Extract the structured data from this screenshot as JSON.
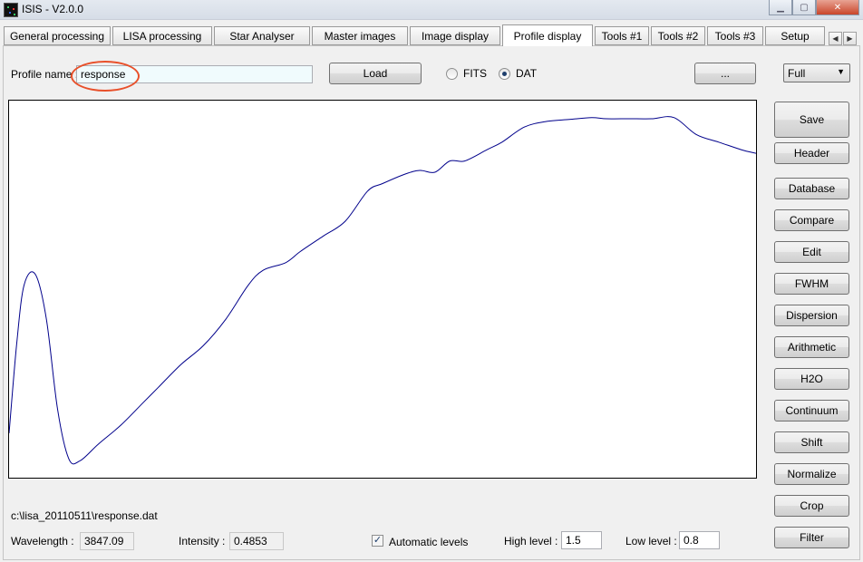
{
  "window": {
    "title": "ISIS - V2.0.0"
  },
  "tabs": [
    {
      "label": "General processing"
    },
    {
      "label": "LISA processing"
    },
    {
      "label": "Star Analyser"
    },
    {
      "label": "Master images"
    },
    {
      "label": "Image display"
    },
    {
      "label": "Profile display",
      "active": true
    },
    {
      "label": "Tools #1"
    },
    {
      "label": "Tools #2"
    },
    {
      "label": "Tools #3"
    },
    {
      "label": "Setup"
    }
  ],
  "profile": {
    "name_label": "Profile name :",
    "name_value": "response",
    "load_label": "Load",
    "format_fits": "FITS",
    "format_dat": "DAT",
    "selected_format": "DAT",
    "browse_label": "...",
    "zoom_value": "Full"
  },
  "side_buttons": {
    "save": "Save",
    "header": "Header",
    "database": "Database",
    "compare": "Compare",
    "edit": "Edit",
    "fwhm": "FWHM",
    "dispersion": "Dispersion",
    "arithmetic": "Arithmetic",
    "h2o": "H2O",
    "continuum": "Continuum",
    "shift": "Shift",
    "normalize": "Normalize",
    "crop": "Crop",
    "filter": "Filter"
  },
  "status": {
    "file_path": "c:\\lisa_20110511\\response.dat",
    "wavelength_label": "Wavelength :",
    "wavelength_value": "3847.09",
    "intensity_label": "Intensity :",
    "intensity_value": "0.4853",
    "auto_levels_label": "Automatic levels",
    "auto_levels_checked": true,
    "high_level_label": "High level :",
    "high_level_value": "1.5",
    "low_level_label": "Low level :",
    "low_level_value": "0.8"
  },
  "plot": {
    "line_color": "#00008b",
    "annotation_color": "#e8502a",
    "profile": [
      [
        0.0,
        0.882
      ],
      [
        0.01,
        0.65
      ],
      [
        0.02,
        0.49
      ],
      [
        0.035,
        0.46
      ],
      [
        0.05,
        0.58
      ],
      [
        0.065,
        0.82
      ],
      [
        0.08,
        0.95
      ],
      [
        0.095,
        0.955
      ],
      [
        0.12,
        0.91
      ],
      [
        0.15,
        0.86
      ],
      [
        0.18,
        0.8
      ],
      [
        0.2,
        0.76
      ],
      [
        0.23,
        0.7
      ],
      [
        0.26,
        0.65
      ],
      [
        0.29,
        0.58
      ],
      [
        0.32,
        0.49
      ],
      [
        0.34,
        0.45
      ],
      [
        0.37,
        0.43
      ],
      [
        0.39,
        0.4
      ],
      [
        0.42,
        0.36
      ],
      [
        0.45,
        0.32
      ],
      [
        0.48,
        0.24
      ],
      [
        0.5,
        0.22
      ],
      [
        0.53,
        0.195
      ],
      [
        0.55,
        0.185
      ],
      [
        0.57,
        0.19
      ],
      [
        0.59,
        0.16
      ],
      [
        0.61,
        0.16
      ],
      [
        0.64,
        0.13
      ],
      [
        0.66,
        0.11
      ],
      [
        0.69,
        0.07
      ],
      [
        0.72,
        0.055
      ],
      [
        0.75,
        0.05
      ],
      [
        0.78,
        0.045
      ],
      [
        0.8,
        0.048
      ],
      [
        0.83,
        0.048
      ],
      [
        0.86,
        0.048
      ],
      [
        0.89,
        0.045
      ],
      [
        0.92,
        0.09
      ],
      [
        0.95,
        0.11
      ],
      [
        0.98,
        0.13
      ],
      [
        1.0,
        0.14
      ]
    ]
  }
}
